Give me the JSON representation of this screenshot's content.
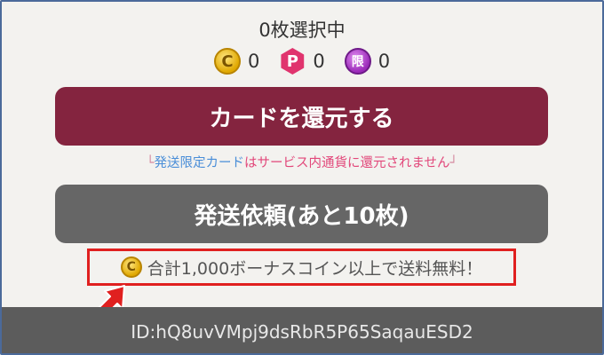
{
  "selection": {
    "label": "0枚選択中"
  },
  "currencies": [
    {
      "icon": "c-coin-icon",
      "symbol": "C",
      "value": "0"
    },
    {
      "icon": "p-point-icon",
      "symbol": "P",
      "value": "0"
    },
    {
      "icon": "limited-coin-icon",
      "symbol": "限",
      "value": "0"
    }
  ],
  "actions": {
    "return_label": "カードを還元する",
    "ship_label": "発送依頼(あと10枚)"
  },
  "notice": {
    "left_bracket": "└",
    "highlight": "発送限定カード",
    "rest": "はサービス内通貨に還元されません",
    "right_bracket": "┘"
  },
  "free_shipping": {
    "coin_symbol": "C",
    "text": "合計1,000ボーナスコイン以上で送料無料！"
  },
  "footer": {
    "id_text": "ID:hQ8uvVMpj9dsRbR5P65SaqauESD2"
  },
  "colors": {
    "return_button": "#84243f",
    "ship_button": "#666666",
    "highlight_box": "#e0201f",
    "notice_pink": "#e2477a",
    "notice_blue": "#4a8ed8"
  }
}
